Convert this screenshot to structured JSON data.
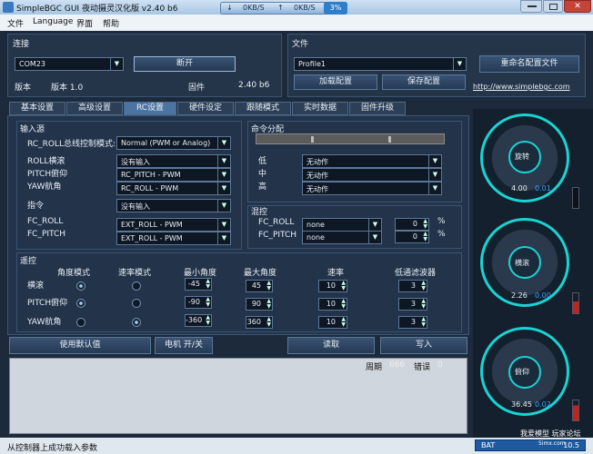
{
  "window": {
    "title": "SimpleBGC GUI 夜动摄灵汉化版 v2.40 b6",
    "net_down": "0KB/S",
    "net_up": "0KB/S",
    "net_pct": "3%"
  },
  "menu": [
    "文件",
    "Language",
    "界面",
    "帮助"
  ],
  "connection": {
    "title": "连接",
    "port": "COM23",
    "disconnect": "断开",
    "ver_label": "版本",
    "ver_value": "版本 1.0",
    "fw_label": "固件",
    "fw_value": "2.40 b6"
  },
  "file": {
    "title": "文件",
    "profile": "Profile1",
    "rename": "重命名配置文件",
    "load": "加载配置",
    "save": "保存配置",
    "url": "http://www.simplebgc.com"
  },
  "tabs": [
    "基本设置",
    "高级设置",
    "RC设置",
    "硬件设定",
    "跟随模式",
    "实时数据",
    "固件升级"
  ],
  "input_src": {
    "title": "输入源",
    "mode_label": "RC_ROLL总线控制模式:",
    "mode_value": "Normal (PWM or Analog)",
    "rows": [
      {
        "label": "ROLL横滚",
        "value": "没有输入"
      },
      {
        "label": "PITCH俯仰",
        "value": "RC_PITCH - PWM"
      },
      {
        "label": "YAW航角",
        "value": "RC_ROLL - PWM"
      }
    ],
    "cmd_label": "指令",
    "cmd_value": "没有输入",
    "fc_rows": [
      {
        "label": "FC_ROLL",
        "value": "EXT_ROLL - PWM"
      },
      {
        "label": "FC_PITCH",
        "value": "EXT_ROLL - PWM"
      }
    ]
  },
  "cmd_assign": {
    "title": "命令分配",
    "rows": [
      {
        "label": "低",
        "value": "无动作"
      },
      {
        "label": "中",
        "value": "无动作"
      },
      {
        "label": "高",
        "value": "无动作"
      }
    ]
  },
  "mix": {
    "title": "混控",
    "rows": [
      {
        "label": "FC_ROLL",
        "value": "none",
        "num": "0",
        "unit": "%"
      },
      {
        "label": "FC_PITCH",
        "value": "none",
        "num": "0",
        "unit": "%"
      }
    ]
  },
  "remote": {
    "title": "遥控",
    "headers": [
      "角度模式",
      "速率模式",
      "最小角度",
      "最大角度",
      "速率",
      "低通滤波器"
    ],
    "rows": [
      {
        "label": "横滚",
        "angle_mode": true,
        "rate_mode": false,
        "min": "-45",
        "max": "45",
        "speed": "10",
        "lpf": "3"
      },
      {
        "label": "PITCH俯仰",
        "angle_mode": true,
        "rate_mode": false,
        "min": "-90",
        "max": "90",
        "speed": "10",
        "lpf": "3"
      },
      {
        "label": "YAW航角",
        "angle_mode": false,
        "rate_mode": true,
        "min": "-360",
        "max": "360",
        "speed": "10",
        "lpf": "3"
      }
    ]
  },
  "actions": {
    "defaults": "使用默认值",
    "motor": "电机 开/关",
    "read": "读取",
    "write": "写入"
  },
  "log": {
    "cycle_label": "周期",
    "cycle_value": "666",
    "err_label": "错误",
    "err_value": "0"
  },
  "dials": [
    {
      "name": "旋转",
      "v1": "4.00",
      "v2": "0.01",
      "color": "#19d4d4"
    },
    {
      "name": "横滚",
      "v1": "2.26",
      "v2": "0.00",
      "color": "#19d4d4"
    },
    {
      "name": "俯仰",
      "v1": "36.45",
      "v2": "0.02",
      "color": "#19d4d4"
    }
  ],
  "status": {
    "message": "从控制器上成功载入参数",
    "bat_label": "BAT",
    "bat_value": "10.5",
    "watermark": "我爱模型 玩家论坛",
    "watermark_sub": "5imx.com"
  },
  "colors": {
    "accent": "#19d4d4",
    "panel": "#253549",
    "bg": "#1c2a3c"
  }
}
